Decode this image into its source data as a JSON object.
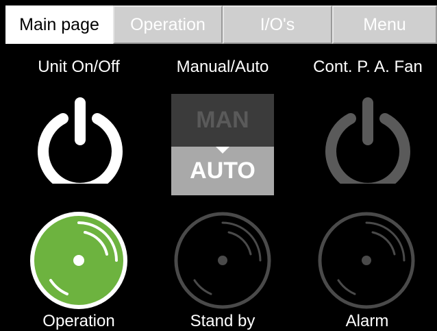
{
  "tabs": [
    {
      "label": "Main page",
      "active": true
    },
    {
      "label": "Operation",
      "active": false
    },
    {
      "label": "I/O's",
      "active": false
    },
    {
      "label": "Menu",
      "active": false
    }
  ],
  "controls": {
    "unit_label": "Unit On/Off",
    "manual_auto_label": "Manual/Auto",
    "fan_label": "Cont. P. A. Fan",
    "man_text": "MAN",
    "auto_text": "AUTO",
    "unit_state": "on",
    "fan_state": "off",
    "mode_selected": "AUTO"
  },
  "indicators": {
    "operation_label": "Operation",
    "standby_label": "Stand by",
    "alarm_label": "Alarm",
    "operation_state": "active",
    "standby_state": "inactive",
    "alarm_state": "inactive"
  },
  "colors": {
    "background": "#000000",
    "active_lamp": "#6db33f",
    "inactive_gray": "#4a4a4a",
    "power_on": "#ffffff",
    "power_off": "#5a5a5a"
  }
}
